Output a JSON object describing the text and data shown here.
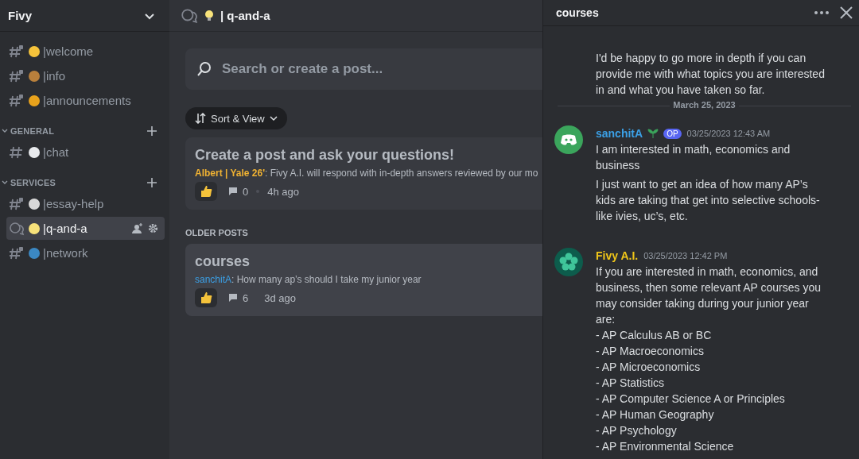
{
  "server": {
    "name": "Fivy"
  },
  "sidebar": {
    "channels": [
      {
        "kind": "locked-text",
        "name": "|welcome",
        "selected": false
      },
      {
        "kind": "locked-text",
        "name": "|info",
        "selected": false
      },
      {
        "kind": "locked-text",
        "name": "|announcements",
        "selected": false
      }
    ],
    "categories": [
      {
        "name": "GENERAL",
        "expanded": true,
        "channels": [
          {
            "kind": "text",
            "name": "|chat",
            "selected": false
          }
        ]
      },
      {
        "name": "SERVICES",
        "expanded": true,
        "channels": [
          {
            "kind": "locked-text",
            "name": "|essay-help",
            "selected": false
          },
          {
            "kind": "forum",
            "name": "|q-and-a",
            "selected": true
          },
          {
            "kind": "locked-text",
            "name": "|network",
            "selected": false
          }
        ]
      }
    ]
  },
  "channel_header": {
    "title": "| q-and-a"
  },
  "forum": {
    "search": {
      "placeholder": "Search or create a post..."
    },
    "sort_button": "Sort & View",
    "pinned_post": {
      "title": "Create a post and ask your questions!",
      "author": "Albert | Yale 26'",
      "color": "#f0b232",
      "preview": ": Fivy A.I. will respond with in-depth answers reviewed by our mo",
      "comments": "0",
      "time": "4h ago"
    },
    "older_label": "OLDER POSTS",
    "posts": [
      {
        "title": "courses",
        "author": "sanchitA",
        "color": "#3ba0e6",
        "preview": ": How many ap’s should I take my junior year",
        "comments": "6",
        "time": "3d ago"
      }
    ]
  },
  "thread": {
    "title": "courses",
    "intro_text": "I'd be happy to go more in depth if you can provide me with what topics you are interested in and what you have taken so far.",
    "date_divider": "March 25, 2023",
    "messages": [
      {
        "kind": "user",
        "author": "sanchitA",
        "color": "#3ba0e6",
        "badge": "OP",
        "timestamp": "03/25/2023 12:43 AM",
        "paragraphs": [
          "I am interested in math, economics and business",
          "I just want to get an idea of how many AP’s kids are taking that get into selective schools-like ivies, uc’s, etc."
        ]
      },
      {
        "kind": "bot",
        "author": "Fivy A.I.",
        "color": "#f0c619",
        "timestamp": "03/25/2023 12:42 PM",
        "paragraphs": [
          "If you are interested in math, economics, and business, then some relevant AP courses you may consider taking during your junior year are:",
          "- AP Calculus AB or BC",
          "- AP Macroeconomics",
          "- AP Microeconomics",
          "- AP Statistics",
          "- AP Computer Science A or Principles",
          "- AP Human Geography",
          "- AP Psychology",
          "- AP Environmental Science"
        ]
      }
    ]
  }
}
